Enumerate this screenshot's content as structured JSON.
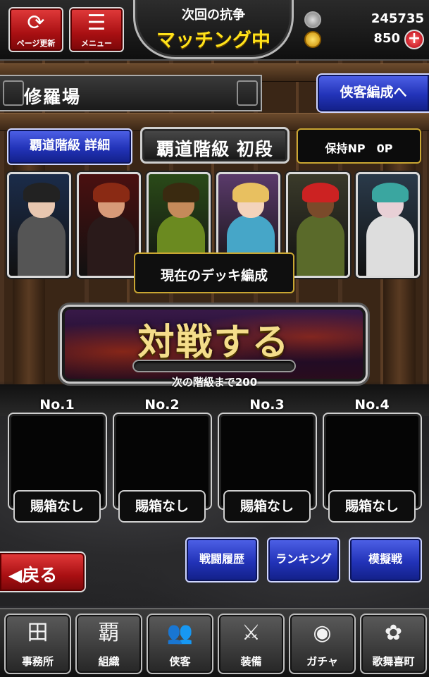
{
  "header": {
    "refresh_label": "ページ更新",
    "menu_label": "メニュー",
    "status_subtitle": "次回の抗争",
    "status_main": "マッチング中",
    "coin_value": "245735",
    "gem_value": "850",
    "plus_symbol": "+"
  },
  "location": {
    "title": "修羅場",
    "edit_button": "侠客編成へ"
  },
  "rank": {
    "detail_button": "覇道階級 詳細",
    "current_rank": "覇道階級 初段",
    "np_label": "保持NP　0P"
  },
  "deck": {
    "label": "現在のデッキ編成",
    "cards": [
      {
        "name": "card-1",
        "bg": "#1b2c4a",
        "hair": "#222",
        "skin": "#e8c7b0",
        "body": "#555"
      },
      {
        "name": "card-2",
        "bg": "#4a1010",
        "hair": "#8a2a14",
        "skin": "#d79a78",
        "body": "#2a1a1a"
      },
      {
        "name": "card-3",
        "bg": "#2a4a18",
        "hair": "#3a2a10",
        "skin": "#c58a5a",
        "body": "#6b8a20"
      },
      {
        "name": "card-4",
        "bg": "#5a3a6a",
        "hair": "#e8c060",
        "skin": "#f3d3bb",
        "body": "#46a6c8"
      },
      {
        "name": "card-5",
        "bg": "#3a3a2a",
        "hair": "#c22",
        "skin": "#7a4a2a",
        "body": "#5a6a2a"
      },
      {
        "name": "card-6",
        "bg": "#2a3a4a",
        "hair": "#3aa6a0",
        "skin": "#e8d0d6",
        "body": "#ddd"
      }
    ]
  },
  "battle": {
    "button_label": "対戦する",
    "progress": 0.0,
    "next_rank_text": "次の階級まで200"
  },
  "slots": [
    {
      "label": "No.1",
      "tag": "賜箱なし"
    },
    {
      "label": "No.2",
      "tag": "賜箱なし"
    },
    {
      "label": "No.3",
      "tag": "賜箱なし"
    },
    {
      "label": "No.4",
      "tag": "賜箱なし"
    }
  ],
  "actions": {
    "history": "戦闘履歴",
    "ranking": "ランキング",
    "mock": "模擬戦",
    "back": "◀戻る"
  },
  "nav": [
    {
      "label": "事務所",
      "icon": "office-icon",
      "glyph": "田"
    },
    {
      "label": "組織",
      "icon": "clan-icon",
      "glyph": "覇"
    },
    {
      "label": "侠客",
      "icon": "members-icon",
      "glyph": "👥"
    },
    {
      "label": "装備",
      "icon": "crossed-swords-icon",
      "glyph": "⚔"
    },
    {
      "label": "ガチャ",
      "icon": "gacha-bowl-icon",
      "glyph": "◉"
    },
    {
      "label": "歌舞喜町",
      "icon": "town-crest-icon",
      "glyph": "✿"
    }
  ],
  "colors": {
    "accent_yellow": "#ffe21a",
    "button_blue": "#2233b8",
    "button_red": "#a80f12",
    "gold_border": "#c9a632"
  }
}
